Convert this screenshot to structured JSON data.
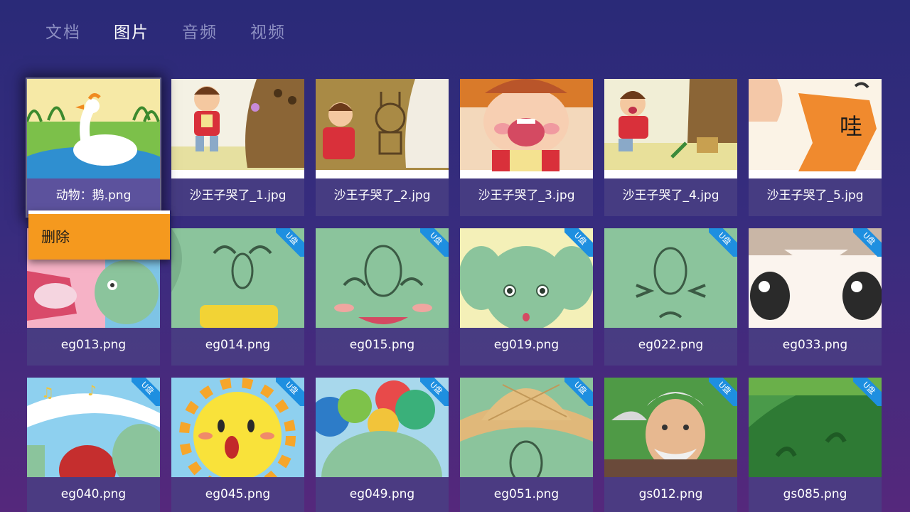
{
  "tabs": [
    {
      "label": "文档",
      "active": false
    },
    {
      "label": "图片",
      "active": true
    },
    {
      "label": "音频",
      "active": false
    },
    {
      "label": "视频",
      "active": false
    }
  ],
  "context_menu": {
    "delete_label": "删除"
  },
  "badge_label": "U盘",
  "images": [
    {
      "name": "动物：鹅.png",
      "badge": false,
      "focused": true,
      "art": "goose"
    },
    {
      "name": "沙王子哭了_1.jpg",
      "badge": false,
      "art": "boy1"
    },
    {
      "name": "沙王子哭了_2.jpg",
      "badge": false,
      "art": "boy2"
    },
    {
      "name": "沙王子哭了_3.jpg",
      "badge": false,
      "art": "cry"
    },
    {
      "name": "沙王子哭了_4.jpg",
      "badge": false,
      "art": "boy4"
    },
    {
      "name": "沙王子哭了_5.jpg",
      "badge": false,
      "art": "wa"
    },
    {
      "name": "eg013.png",
      "badge": true,
      "art": "eleph-donkey"
    },
    {
      "name": "eg014.png",
      "badge": true,
      "art": "eleph-happy"
    },
    {
      "name": "eg015.png",
      "badge": true,
      "art": "eleph-smile"
    },
    {
      "name": "eg019.png",
      "badge": true,
      "art": "eleph-wonder"
    },
    {
      "name": "eg022.png",
      "badge": true,
      "art": "eleph-cross"
    },
    {
      "name": "eg033.png",
      "badge": true,
      "art": "eyes"
    },
    {
      "name": "eg040.png",
      "badge": true,
      "art": "music"
    },
    {
      "name": "eg045.png",
      "badge": true,
      "art": "sun"
    },
    {
      "name": "eg049.png",
      "badge": true,
      "art": "balloons"
    },
    {
      "name": "eg051.png",
      "badge": true,
      "art": "hat"
    },
    {
      "name": "gs012.png",
      "badge": true,
      "art": "oldman"
    },
    {
      "name": "gs085.png",
      "badge": true,
      "art": "hills"
    }
  ],
  "colors": {
    "accent_menu": "#f5991e",
    "badge": "#1e8fe0",
    "tab_inactive": "#8d8fc2",
    "tab_active": "#ffffff"
  }
}
